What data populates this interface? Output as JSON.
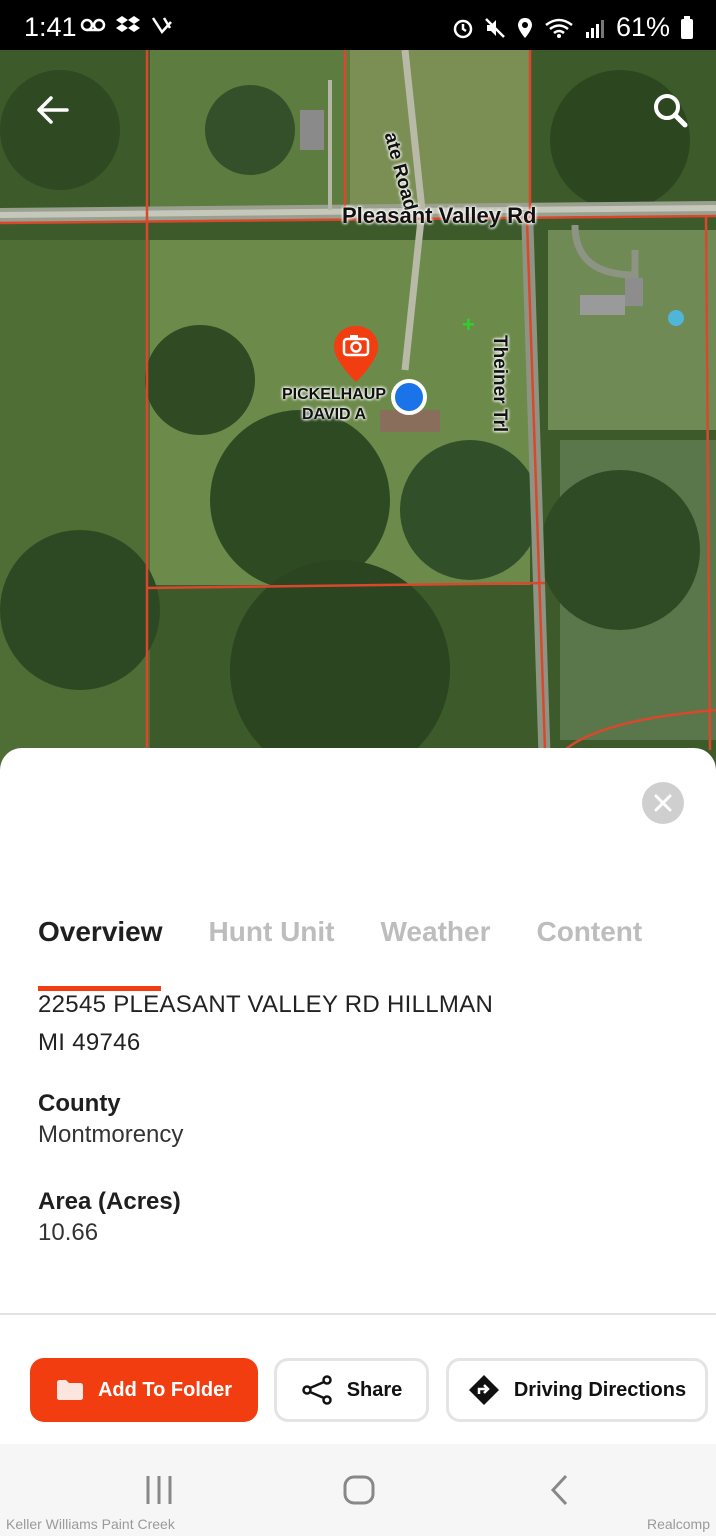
{
  "status_bar": {
    "time": "1:41",
    "battery": "61%",
    "left_icons": [
      "voicemail-icon",
      "dropbox-icon",
      "notification-icon"
    ],
    "right_icons": [
      "alarm-icon",
      "mute-icon",
      "location-icon",
      "wifi-icon",
      "signal-icon",
      "battery-icon"
    ]
  },
  "map": {
    "roads": [
      "Pleasant Valley Rd",
      "Theiner Trl",
      "ate Road"
    ],
    "owner_label_line1": "PICKELHAUP",
    "owner_label_line2": "DAVID A",
    "icons": [
      "back-arrow-icon",
      "search-icon",
      "camera-pin-icon",
      "location-dot",
      "crosshair-icon"
    ]
  },
  "tabs": [
    {
      "label": "Overview",
      "active": true
    },
    {
      "label": "Hunt Unit",
      "active": false
    },
    {
      "label": "Weather",
      "active": false
    },
    {
      "label": "Content",
      "active": false
    }
  ],
  "parcel": {
    "address_line1": "22545 PLEASANT VALLEY RD HILLMAN",
    "address_line2": "MI 49746",
    "county_label": "County",
    "county_value": "Montmorency",
    "area_label": "Area (Acres)",
    "area_value": "10.66"
  },
  "actions": {
    "add_to_folder": "Add To Folder",
    "share": "Share",
    "driving_directions": "Driving Directions"
  },
  "watermarks": {
    "left": "Keller Williams Paint Creek",
    "right": "Realcomp"
  },
  "colors": {
    "accent": "#f23d11",
    "parcel_line": "#d9482c",
    "location_dot": "#1a73e8"
  }
}
